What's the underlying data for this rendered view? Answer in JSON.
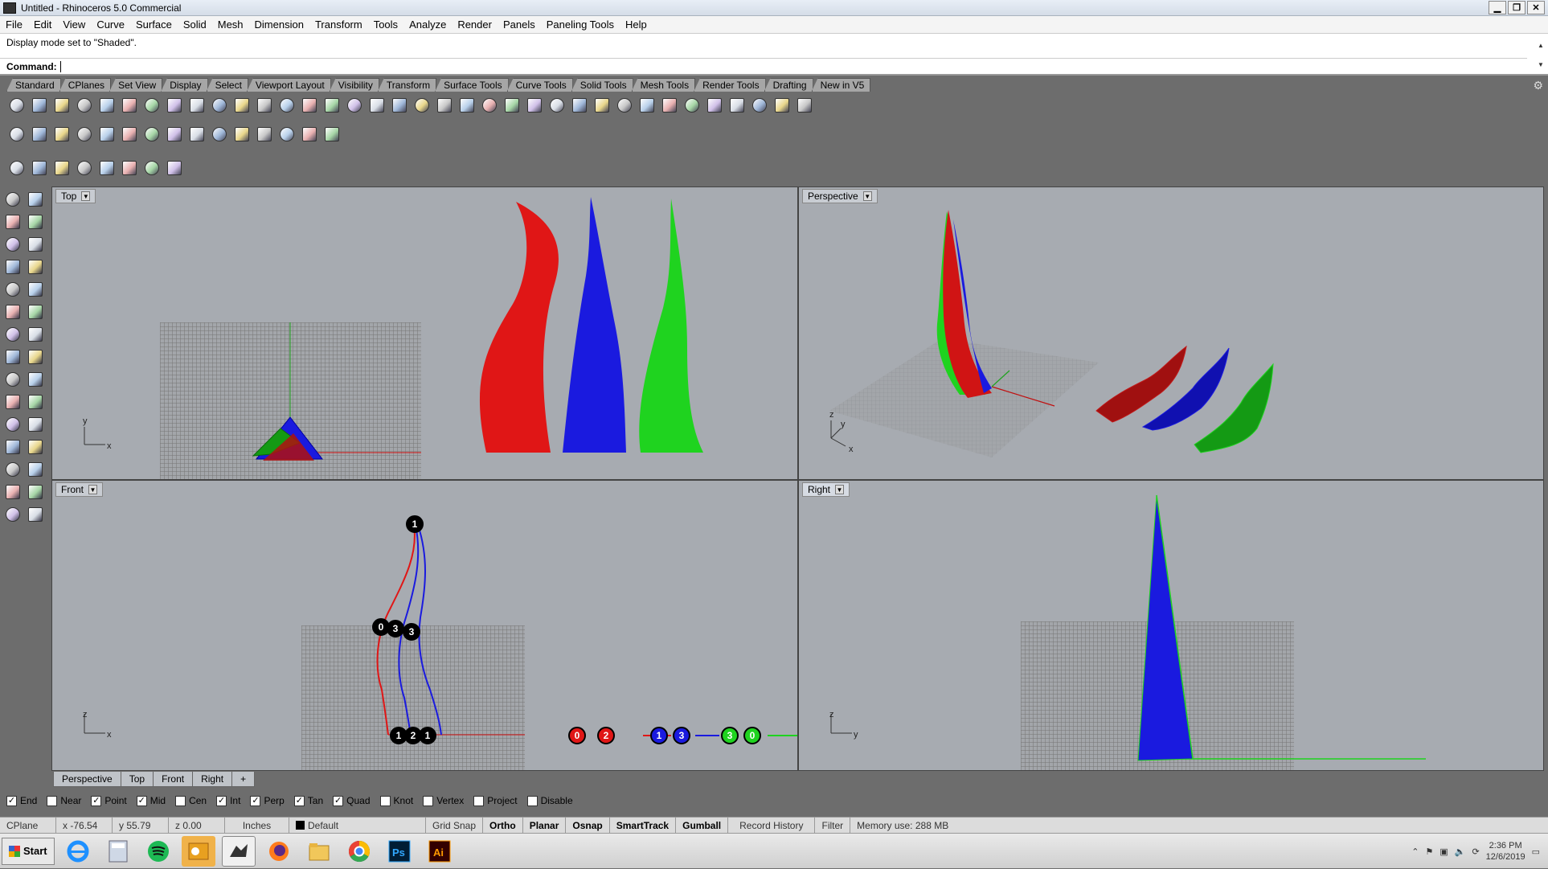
{
  "window": {
    "title": "Untitled - Rhinoceros 5.0 Commercial",
    "btn_min": "▁",
    "btn_max": "❐",
    "btn_close": "✕"
  },
  "menu": [
    "File",
    "Edit",
    "View",
    "Curve",
    "Surface",
    "Solid",
    "Mesh",
    "Dimension",
    "Transform",
    "Tools",
    "Analyze",
    "Render",
    "Panels",
    "Paneling Tools",
    "Help"
  ],
  "command": {
    "history": "Display mode set to \"Shaded\".",
    "prompt": "Command:"
  },
  "toolbar_tabs": [
    "Standard",
    "CPlanes",
    "Set View",
    "Display",
    "Select",
    "Viewport Layout",
    "Visibility",
    "Transform",
    "Surface Tools",
    "Curve Tools",
    "Solid Tools",
    "Mesh Tools",
    "Render Tools",
    "Drafting",
    "New in V5"
  ],
  "viewports": {
    "top": {
      "title": "Top"
    },
    "perspective": {
      "title": "Perspective"
    },
    "front": {
      "title": "Front"
    },
    "right": {
      "title": "Right"
    }
  },
  "axis_labels": {
    "x": "x",
    "y": "y",
    "z": "z"
  },
  "front_badges": {
    "top_pt": "1",
    "mid": [
      "0",
      "3",
      "3"
    ],
    "bottom": [
      "1",
      "2",
      "1"
    ],
    "legend": [
      {
        "label": "0",
        "color": "#e01616"
      },
      {
        "label": "2",
        "color": "#e01616"
      },
      {
        "label": "1",
        "color": "#1a1adf"
      },
      {
        "label": "3",
        "color": "#1a1adf"
      },
      {
        "label": "3",
        "color": "#1fd31f"
      },
      {
        "label": "0",
        "color": "#1fd31f"
      }
    ]
  },
  "viewport_tabs": [
    "Perspective",
    "Top",
    "Front",
    "Right",
    "+"
  ],
  "osnaps": [
    {
      "label": "End",
      "checked": true
    },
    {
      "label": "Near",
      "checked": false
    },
    {
      "label": "Point",
      "checked": true
    },
    {
      "label": "Mid",
      "checked": true
    },
    {
      "label": "Cen",
      "checked": false
    },
    {
      "label": "Int",
      "checked": true
    },
    {
      "label": "Perp",
      "checked": true
    },
    {
      "label": "Tan",
      "checked": true
    },
    {
      "label": "Quad",
      "checked": true
    },
    {
      "label": "Knot",
      "checked": false
    },
    {
      "label": "Vertex",
      "checked": false
    },
    {
      "label": "Project",
      "checked": false
    },
    {
      "label": "Disable",
      "checked": false
    }
  ],
  "status": {
    "cplane": "CPlane",
    "x": "x -76.54",
    "y": "y 55.79",
    "z": "z 0.00",
    "units": "Inches",
    "layer": "Default",
    "grid_snap": "Grid Snap",
    "ortho": "Ortho",
    "planar": "Planar",
    "osnap": "Osnap",
    "smarttrack": "SmartTrack",
    "gumball": "Gumball",
    "record_history": "Record History",
    "filter": "Filter",
    "memory": "Memory use: 288 MB"
  },
  "taskbar": {
    "start": "Start",
    "time": "2:36 PM",
    "date": "12/6/2019"
  },
  "colors": {
    "red": "#e01616",
    "blue": "#1a1adf",
    "green": "#1fd31f",
    "dark_red": "#a01010",
    "dark_blue": "#1010b0",
    "dark_green": "#149a14"
  }
}
